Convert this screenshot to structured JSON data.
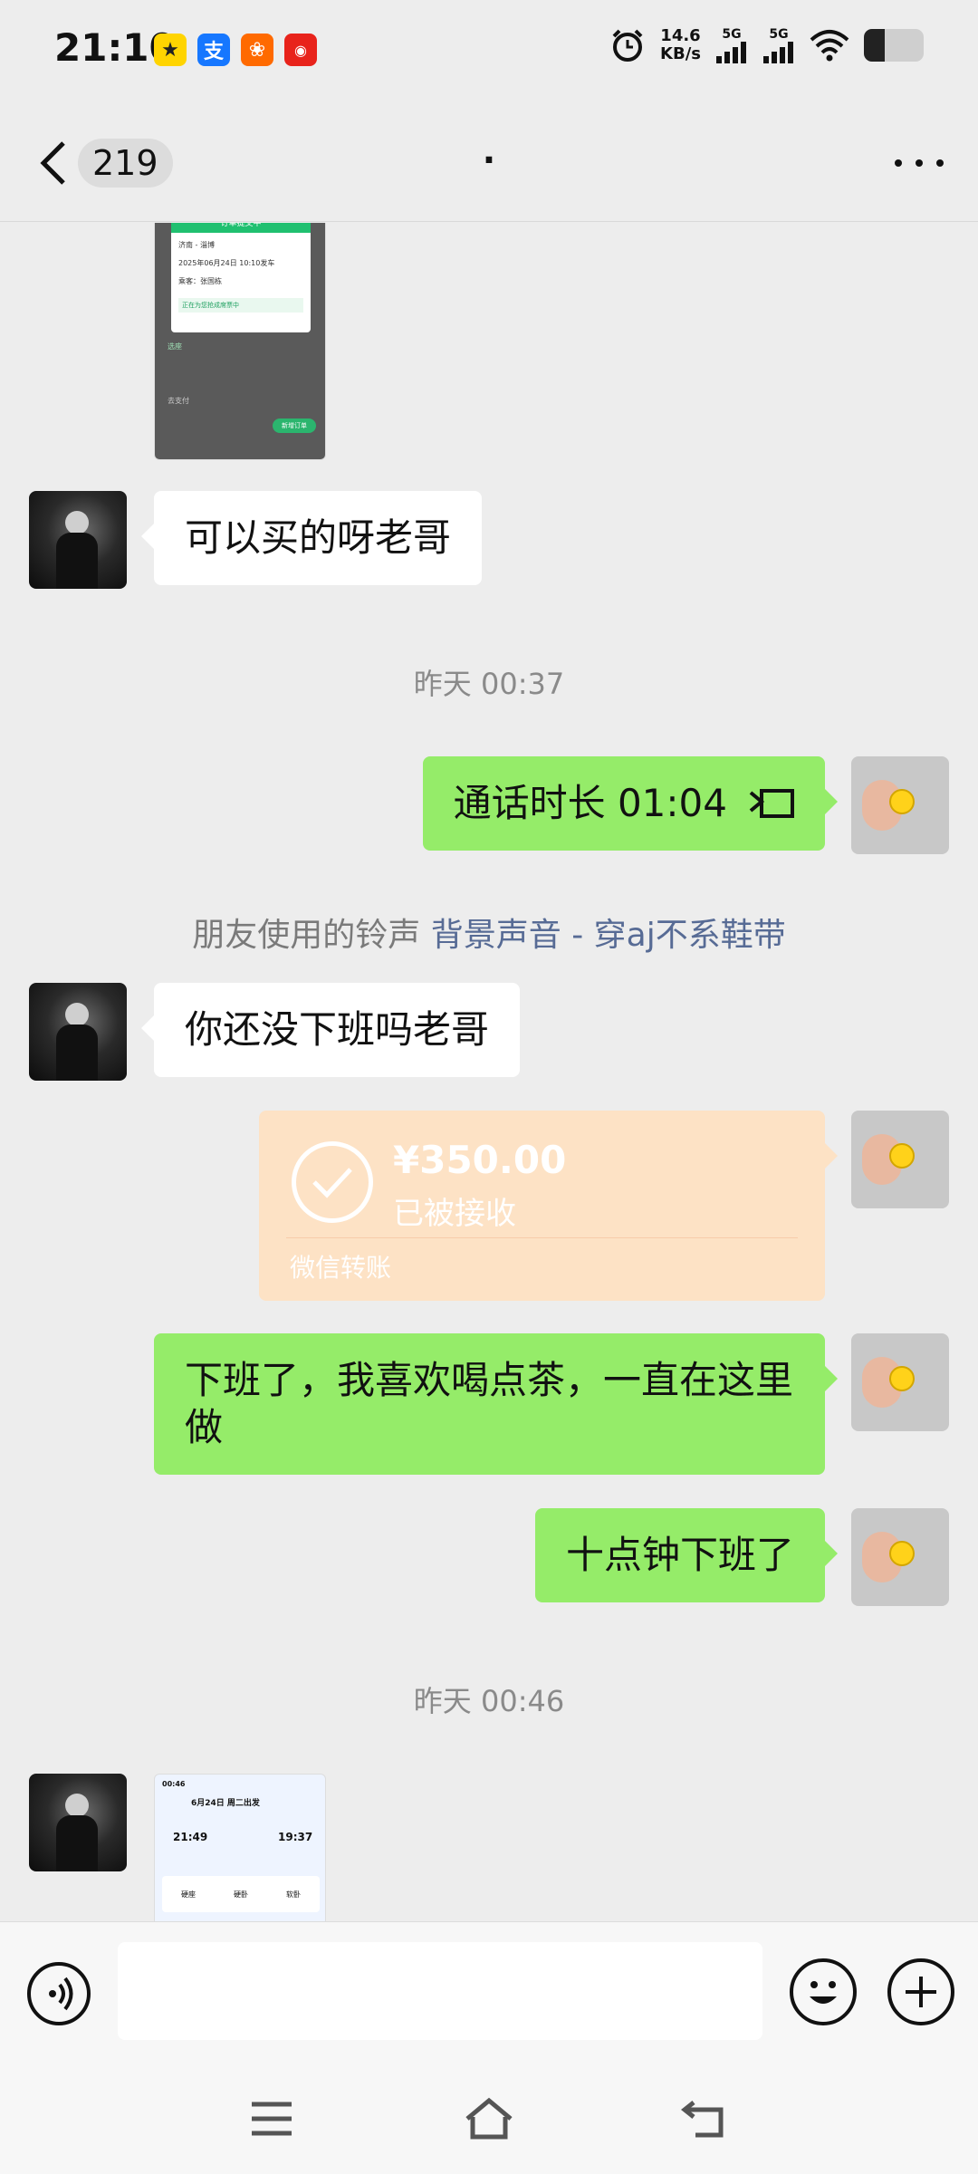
{
  "status_bar": {
    "time": "21:10",
    "app_icons": [
      "notification-app-icon",
      "alipay-icon",
      "app-icon-orange",
      "app-icon-red"
    ],
    "net_speed_value": "14.6",
    "net_speed_unit": "KB/s",
    "sim1": "5G",
    "sim2": "5G",
    "battery_level": 0.35
  },
  "nav": {
    "unread_count": "219",
    "title": ".",
    "back_icon": "chevron-left-icon",
    "more_icon": "more-dots-icon"
  },
  "messages": {
    "m1": "可以买的呀老哥",
    "ts1": "昨天 00:37",
    "call": "通话时长 01:04",
    "ringtone_prefix": "朋友使用的铃声",
    "ringtone_link": "背景声音 - 穿aj不系鞋带",
    "m2": "你还没下班吗老哥",
    "transfer_amount": "¥350.00",
    "transfer_status": "已被接收",
    "transfer_label": "微信转账",
    "m3": "下班了，我喜欢喝点茶，一直在这里做",
    "m4": "十点钟下班了",
    "ts2": "昨天 00:46"
  },
  "thumb_order": {
    "rows": [
      "订单提交中",
      "济南 - 淄博",
      "2025年06月24日 10:10发车",
      "乘客：张国栋",
      "正在为您抢成席票中",
      "选座",
      "去支付",
      "新增订单"
    ]
  },
  "thumb_train": {
    "time": "00:46",
    "date": "6月24日 周二出发",
    "depart": "21:49",
    "arrive": "19:37",
    "seats": [
      "硬座",
      "硬卧",
      "软卧"
    ]
  },
  "input": {
    "placeholder": ""
  },
  "colors": {
    "sent_bubble": "#95ec69",
    "received_bubble": "#ffffff",
    "transfer_bg": "#fde2c5",
    "link": "#576b95",
    "background": "#ededed"
  }
}
